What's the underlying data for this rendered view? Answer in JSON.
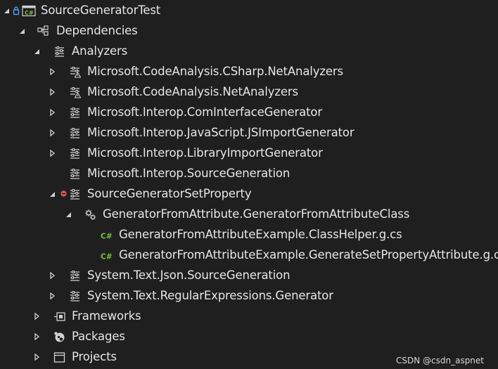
{
  "tree": {
    "project": {
      "label": "SourceGeneratorTest",
      "icon": "csharp-project-icon"
    },
    "dependencies": {
      "label": "Dependencies",
      "icon": "dependencies-icon"
    },
    "analyzers": {
      "label": "Analyzers",
      "icon": "analyzer-icon"
    },
    "analyzer_items": [
      {
        "label": "Microsoft.CodeAnalysis.CSharp.NetAnalyzers",
        "icon": "analyzer-warning-icon",
        "expandable": true
      },
      {
        "label": "Microsoft.CodeAnalysis.NetAnalyzers",
        "icon": "analyzer-warning-icon",
        "expandable": true
      },
      {
        "label": "Microsoft.Interop.ComInterfaceGenerator",
        "icon": "analyzer-icon",
        "expandable": true
      },
      {
        "label": "Microsoft.Interop.JavaScript.JSImportGenerator",
        "icon": "analyzer-icon",
        "expandable": true
      },
      {
        "label": "Microsoft.Interop.LibraryImportGenerator",
        "icon": "analyzer-icon",
        "expandable": true
      },
      {
        "label": "Microsoft.Interop.SourceGeneration",
        "icon": "analyzer-icon",
        "expandable": false
      }
    ],
    "source_generator_set_property": {
      "label": "SourceGeneratorSetProperty",
      "icon": "analyzer-icon"
    },
    "generator_from_attribute": {
      "label": "GeneratorFromAttribute.GeneratorFromAttributeClass",
      "icon": "generator-gears-icon"
    },
    "generated_files": [
      {
        "label": "GeneratorFromAttributeExample.ClassHelper.g.cs",
        "icon": "csharp-file-icon"
      },
      {
        "label": "GeneratorFromAttributeExample.GenerateSetPropertyAttribute.g.cs",
        "icon": "csharp-file-icon"
      }
    ],
    "analyzer_items_after": [
      {
        "label": "System.Text.Json.SourceGeneration",
        "icon": "analyzer-icon"
      },
      {
        "label": "System.Text.RegularExpressions.Generator",
        "icon": "analyzer-icon"
      }
    ],
    "frameworks": {
      "label": "Frameworks",
      "icon": "framework-icon"
    },
    "packages": {
      "label": "Packages",
      "icon": "package-icon"
    },
    "projects": {
      "label": "Projects",
      "icon": "project-reference-icon"
    }
  },
  "watermark": "CSDN @csdn_aspnet",
  "colors": {
    "background": "#1f1f1f",
    "text": "#e6e6e6",
    "expander": "#cfcfcf",
    "lock_blue": "#4da3ff",
    "csharp_green": "#7ec33a",
    "error_red": "#e0514f"
  }
}
